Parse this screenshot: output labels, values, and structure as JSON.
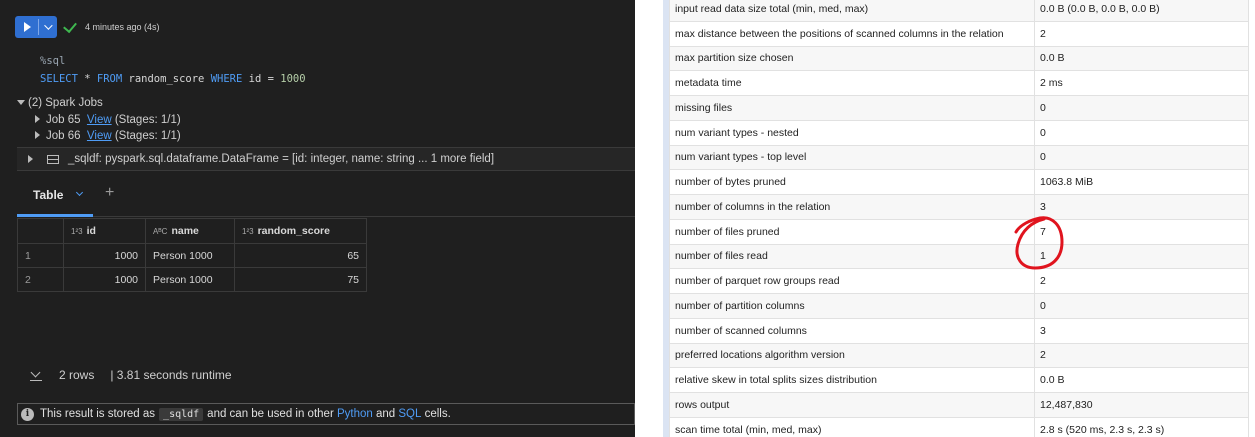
{
  "cell": {
    "status_text": "4 minutes ago (4s)",
    "code": {
      "magic": "%sql",
      "select": "SELECT",
      "star": " * ",
      "from": "FROM",
      "table": " random_score ",
      "where": "WHERE",
      "cond": " id = ",
      "value": "1000"
    },
    "spark_jobs": {
      "header": "(2) Spark Jobs",
      "jobs": [
        {
          "name": "Job 65",
          "link": "View",
          "stages": "(Stages: 1/1)"
        },
        {
          "name": "Job 66",
          "link": "View",
          "stages": "(Stages: 1/1)"
        }
      ]
    },
    "dataframe": "_sqldf:  pyspark.sql.dataframe.DataFrame = [id: integer, name: string ... 1 more field]",
    "tab_label": "Table",
    "tab_add": "+",
    "result": {
      "columns": [
        {
          "type": "1²3",
          "name": "id"
        },
        {
          "type": "AᴮC",
          "name": "name"
        },
        {
          "type": "1²3",
          "name": "random_score"
        }
      ],
      "rows": [
        {
          "n": "1",
          "id": "1000",
          "name": "Person 1000",
          "score": "65"
        },
        {
          "n": "2",
          "id": "1000",
          "name": "Person 1000",
          "score": "75"
        }
      ]
    },
    "footer": {
      "rows": "2 rows",
      "runtime": "|  3.81 seconds runtime"
    },
    "info": {
      "prefix": "This result is stored as",
      "var": "_sqldf",
      "middle": "and can be used in other",
      "python": "Python",
      "and": "and",
      "sql": "SQL",
      "suffix": "cells."
    }
  },
  "metrics": [
    {
      "k": "input read data size total (min, med, max)",
      "v": "0.0 B (0.0 B, 0.0 B, 0.0 B)"
    },
    {
      "k": "max distance between the positions of scanned columns in the relation",
      "v": "2"
    },
    {
      "k": "max partition size chosen",
      "v": "0.0 B"
    },
    {
      "k": "metadata time",
      "v": "2 ms"
    },
    {
      "k": "missing files",
      "v": "0"
    },
    {
      "k": "num variant types - nested",
      "v": "0"
    },
    {
      "k": "num variant types - top level",
      "v": "0"
    },
    {
      "k": "number of bytes pruned",
      "v": "1063.8 MiB"
    },
    {
      "k": "number of columns in the relation",
      "v": "3"
    },
    {
      "k": "number of files pruned",
      "v": "7"
    },
    {
      "k": "number of files read",
      "v": "1"
    },
    {
      "k": "number of parquet row groups read",
      "v": "2"
    },
    {
      "k": "number of partition columns",
      "v": "0"
    },
    {
      "k": "number of scanned columns",
      "v": "3"
    },
    {
      "k": "preferred locations algorithm version",
      "v": "2"
    },
    {
      "k": "relative skew in total splits sizes distribution",
      "v": "0.0 B"
    },
    {
      "k": "rows output",
      "v": "12,487,830"
    },
    {
      "k": "scan time total (min, med, max)",
      "v": "2.8 s (520 ms, 2.3 s, 2.3 s)"
    }
  ],
  "colors": {
    "accent": "#4f9cf5",
    "success": "#3fb950",
    "annotation": "#e0141e"
  }
}
